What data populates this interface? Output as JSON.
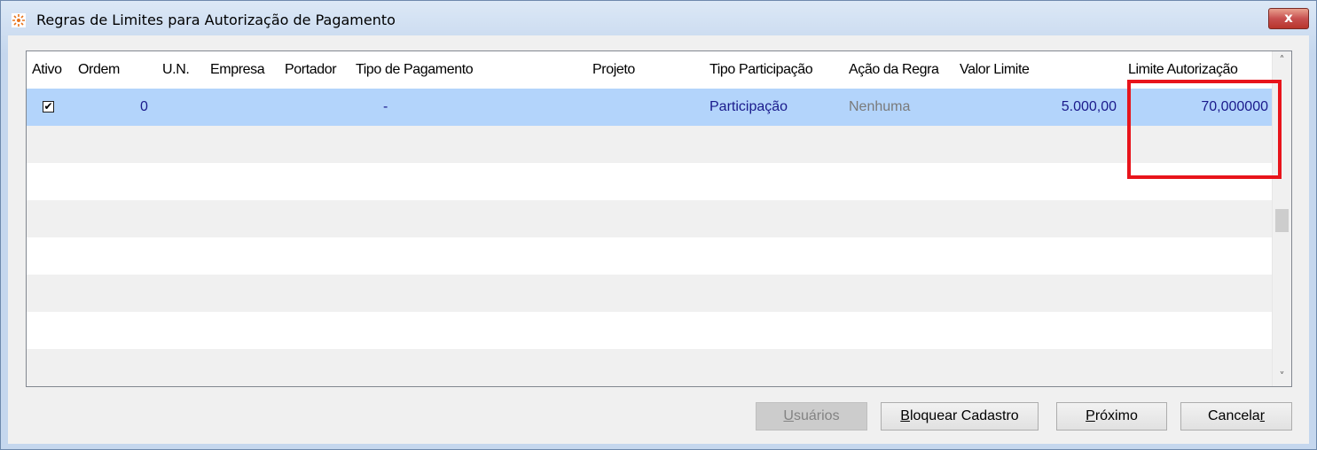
{
  "window": {
    "title": "Regras de Limites para Autorização de Pagamento",
    "close_label": "x"
  },
  "grid": {
    "columns": [
      "Ativo",
      "Ordem",
      "U.N.",
      "Empresa",
      "Portador",
      "Tipo de Pagamento",
      "Projeto",
      "Tipo Participação",
      "Ação da Regra",
      "Valor Limite",
      "Limite Autorização"
    ],
    "rows": [
      {
        "ativo_checked": true,
        "ativo_mark": "✔",
        "ordem": "0",
        "un": "",
        "empresa": "",
        "portador": "",
        "tipo_pagamento": "-",
        "projeto": "",
        "tipo_participacao": "Participação",
        "acao_regra": "Nenhuma",
        "valor_limite": "5.000,00",
        "limite_autorizacao": "70,000000"
      }
    ],
    "scroll_up": "˄",
    "scroll_down": "˅"
  },
  "buttons": {
    "usuarios": {
      "first": "U",
      "rest": "suários"
    },
    "bloquear": {
      "first": "B",
      "rest": "loquear Cadastro"
    },
    "proximo": {
      "first": "P",
      "rest": "róximo"
    },
    "cancelar": {
      "prefix": "Cancela",
      "last": "r"
    }
  },
  "colors": {
    "selected_row": "#b3d4fb",
    "participacao_text": "#1a1a8c",
    "nenhuma_text": "#7a7a7a",
    "highlight": "#e8141b"
  }
}
